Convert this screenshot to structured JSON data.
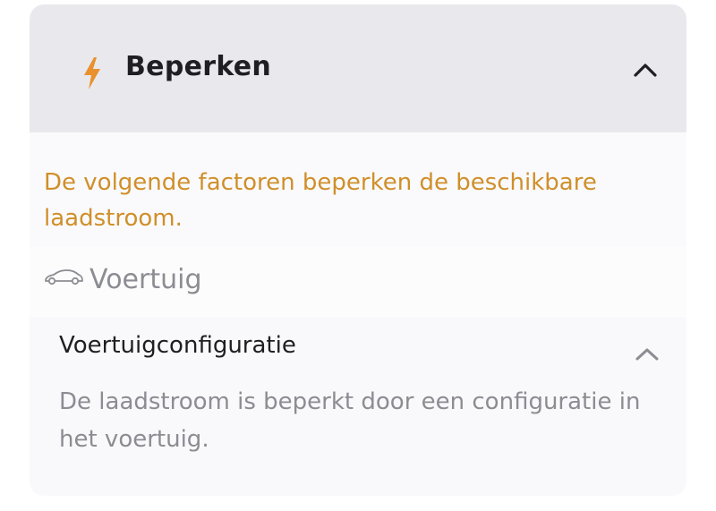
{
  "header": {
    "title": "Beperken",
    "icon": "lightning-bolt-icon",
    "toggle_icon": "chevron-up-icon",
    "accent_color": "#e8912e"
  },
  "intro": {
    "text": "De volgende factoren beperken de beschikbare laadstroom.",
    "color": "#d08f2a"
  },
  "vehicle": {
    "label": "Voertuig",
    "icon": "car-icon"
  },
  "configuration": {
    "title": "Voertuigconfiguratie",
    "description": "De laadstroom is beperkt door een configuratie in het voertuig.",
    "toggle_icon": "chevron-up-icon"
  }
}
